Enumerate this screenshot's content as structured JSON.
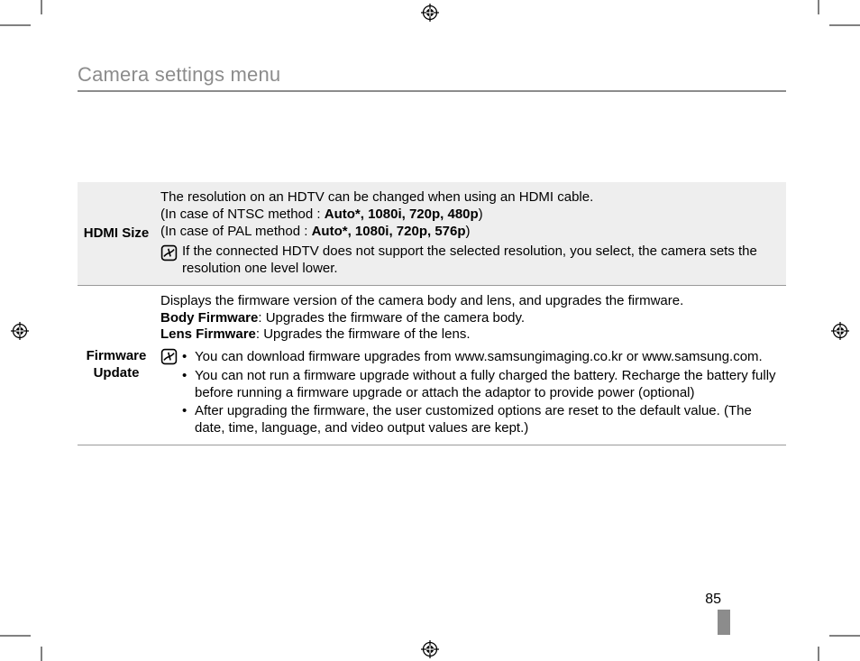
{
  "page_title": "Camera settings menu",
  "page_number": "85",
  "rows": {
    "hdmi": {
      "label": "HDMI Size",
      "line1": "The resolution on an HDTV can be changed when using an HDMI cable.",
      "ntsc_prefix": "(In case of NTSC method : ",
      "ntsc_options": "Auto*, 1080i, 720p, 480p",
      "ntsc_suffix": ")",
      "pal_prefix": "(In case of PAL method : ",
      "pal_options": "Auto*, 1080i, 720p, 576p",
      "pal_suffix": ")",
      "note": "If the connected HDTV does not support the selected resolution, you select, the camera sets the resolution one level lower."
    },
    "fw": {
      "label": "Firmware Update",
      "line1": "Displays the firmware version of the camera body and lens, and upgrades the firmware.",
      "body_label": "Body Firmware",
      "body_desc": ": Upgrades the firmware of the camera body.",
      "lens_label": "Lens Firmware",
      "lens_desc": ": Upgrades the firmware of the lens.",
      "bullets": [
        "You can download firmware upgrades from www.samsungimaging.co.kr or www.samsung.com.",
        "You can not run a firmware upgrade without a fully charged the battery. Recharge the battery fully before running a firmware upgrade or attach the adaptor to provide power (optional)",
        "After upgrading the firmware, the user customized options are reset to the default value. (The date, time, language, and video output values are kept.)"
      ]
    }
  }
}
